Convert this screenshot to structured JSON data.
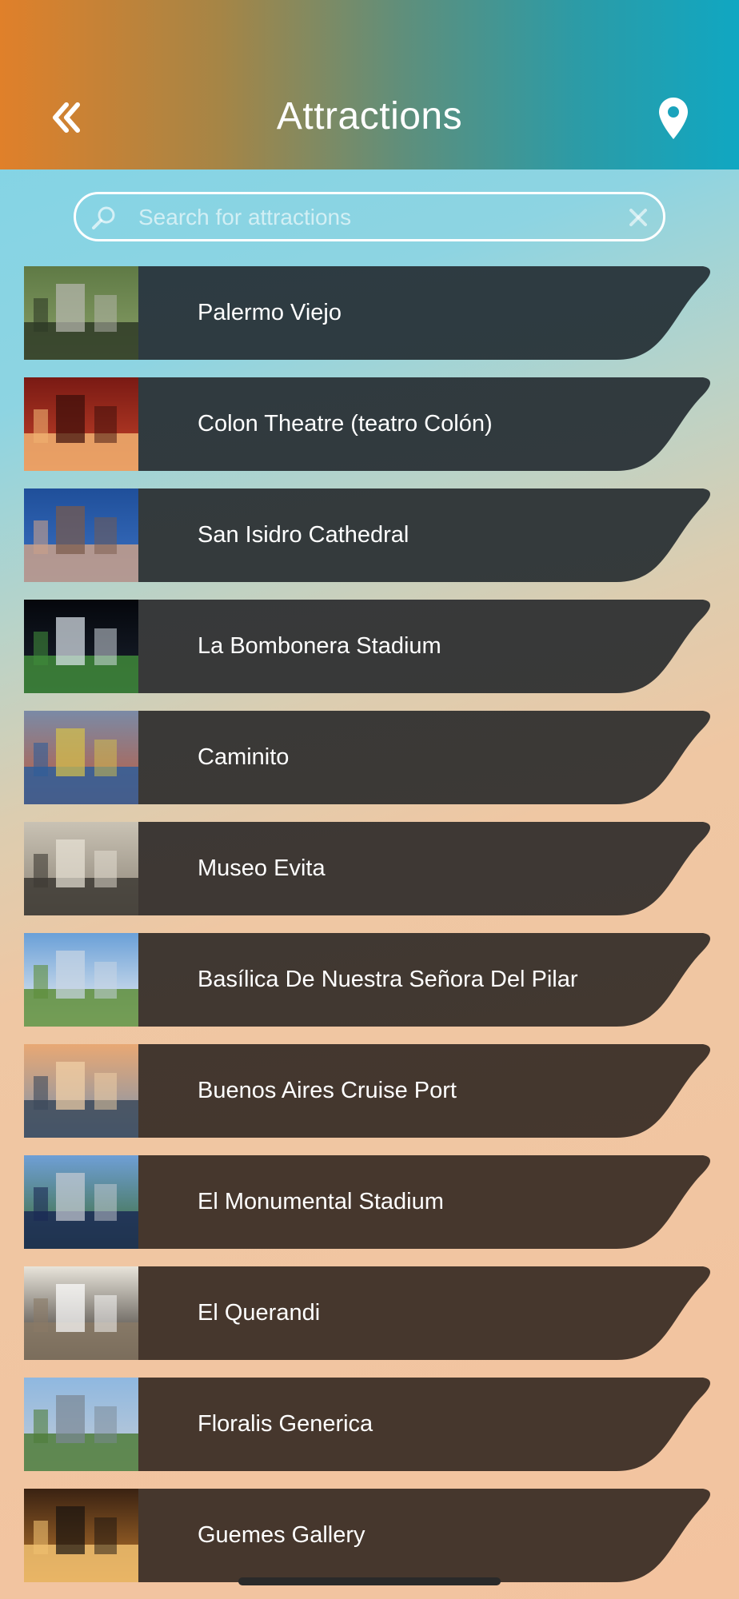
{
  "header": {
    "title": "Attractions",
    "back_icon": "double-chevron-left-icon",
    "map_icon": "map-pin-icon"
  },
  "search": {
    "placeholder": "Search for attractions",
    "value": "",
    "icon": "search-icon",
    "clear_icon": "close-icon"
  },
  "attractions": [
    {
      "name": "Palermo Viejo",
      "photo": "tree-lined-street"
    },
    {
      "name": "Colon Theatre (teatro Colón)",
      "photo": "opera-house-interior"
    },
    {
      "name": "San Isidro Cathedral",
      "photo": "gothic-cathedral"
    },
    {
      "name": "La Bombonera Stadium",
      "photo": "night-stadium"
    },
    {
      "name": "Caminito",
      "photo": "colorful-street"
    },
    {
      "name": "Museo Evita",
      "photo": "museum-facade"
    },
    {
      "name": "Basílica De Nuestra Señora Del Pilar",
      "photo": "white-basilica"
    },
    {
      "name": "Buenos Aires Cruise Port",
      "photo": "waterfront-skyline"
    },
    {
      "name": "El Monumental Stadium",
      "photo": "day-stadium"
    },
    {
      "name": "El Querandi",
      "photo": "restaurant-interior"
    },
    {
      "name": "Floralis Generica",
      "photo": "metal-flower-sculpture"
    },
    {
      "name": "Guemes Gallery",
      "photo": "shopping-gallery"
    }
  ],
  "colors": {
    "banner_top": "#2d3b42",
    "banner_bottom": "#46372d",
    "header_left": "#e0802a",
    "header_right": "#10a7c2"
  }
}
